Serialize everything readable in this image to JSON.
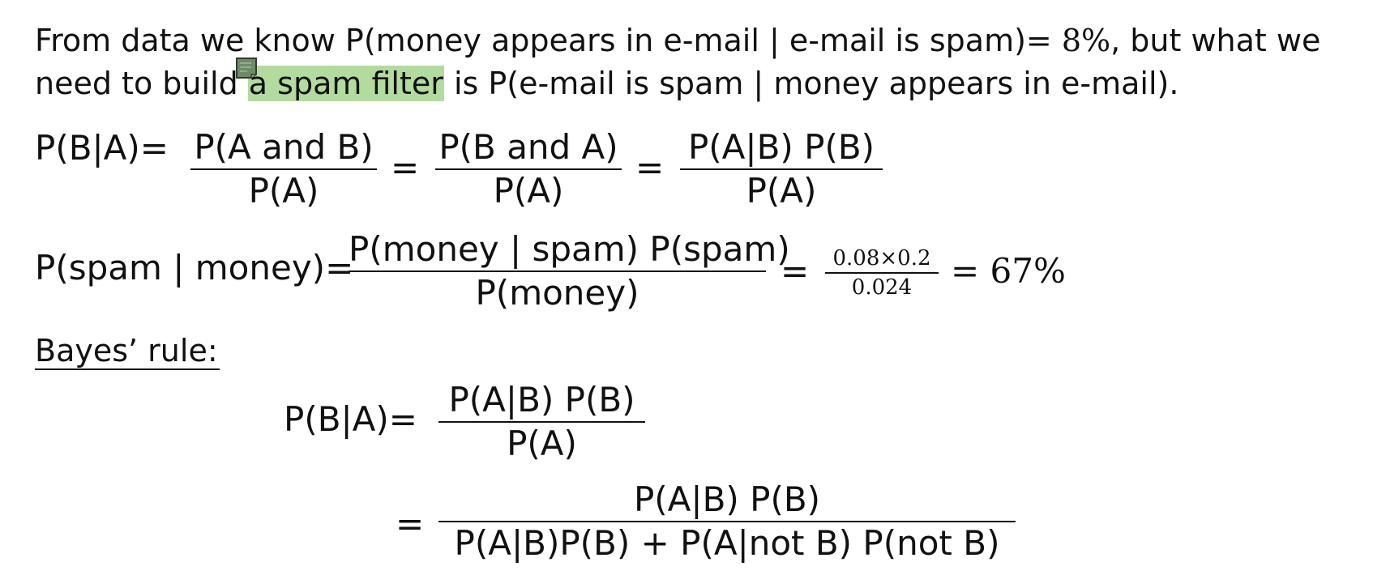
{
  "intro": {
    "line1_a": "From data we know P(money appears in e-mail | e-mail is spam)",
    "line1_eq": "= 8%",
    "line1_b": ", but what we",
    "line2_a": "need to build ",
    "line2_highlight": "a spam filter",
    "line2_b": " is P(e-mail is spam | money appears in e-mail)."
  },
  "equation1": {
    "lhs": "P(B|A)=",
    "f1_num": "P(A and B)",
    "f1_den": "P(A)",
    "eq1": "=",
    "f2_num": "P(B and A)",
    "f2_den": "P(A)",
    "eq2": "=",
    "f3_num": "P(A|B) P(B)",
    "f3_den": "P(A)"
  },
  "equation2": {
    "lhs": "P(spam | money)=",
    "f1_num": "P(money | spam) P(spam)",
    "f1_den": "P(money)",
    "eq1": "=",
    "f2_num": "0.08×0.2",
    "f2_den": "0.024",
    "result": "= 67%"
  },
  "bayes": {
    "label": "Bayes’ rule:",
    "lhs": "P(B|A)=",
    "f1_num": "P(A|B) P(B)",
    "f1_den": "P(A)",
    "eq": "=",
    "f2_num": "P(A|B) P(B)",
    "f2_den": "P(A|B)P(B) + P(A|not B) P(not B)"
  },
  "colors": {
    "highlight": "#b3dba0",
    "note_icon": "#6f8a6a"
  },
  "icons": {
    "note": "sticky-note-icon"
  }
}
